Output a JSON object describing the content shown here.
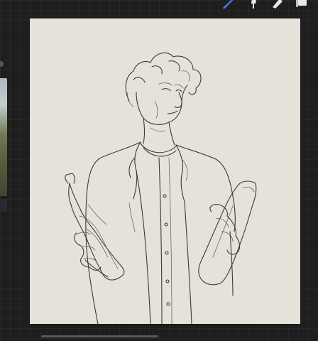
{
  "toolbar": {
    "tools": [
      {
        "name": "brush-icon",
        "active": true,
        "color": "#3b7bf0"
      },
      {
        "name": "smudge-icon",
        "active": false,
        "color": "#e8e8e8"
      },
      {
        "name": "eraser-icon",
        "active": false,
        "color": "#e8e8e8"
      },
      {
        "name": "layers-icon",
        "active": false,
        "color": "#e8e8e8"
      }
    ]
  },
  "canvas": {
    "background_color": "#e5e2d9",
    "subject": "pencil-sketch"
  },
  "workspace": {
    "background_color": "#1e1e1e"
  }
}
